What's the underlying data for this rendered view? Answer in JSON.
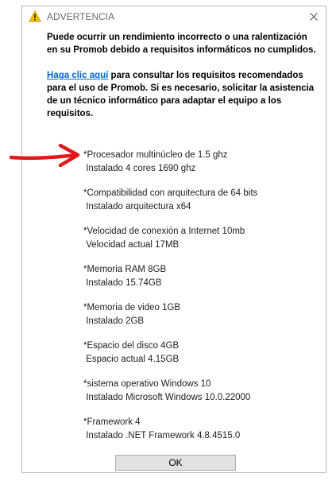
{
  "dialog": {
    "title": "ADVERTENCIA",
    "warning_message": "Puede ocurrir un rendimiento incorrecto o una ralentización en su Promob debido a requisitos informáticos no cumplidos.",
    "link_text": "Haga clic aquí",
    "info_message": " para consultar los requisitos recomendados para el uso de Promob. Si es necesario, solicitar la asistencia de un técnico informático para adaptar el equipo a los requisitos.",
    "ok_label": "OK"
  },
  "requirements": [
    {
      "required": "*Procesador multinúcleo de 1.5 ghz",
      "actual": " Instalado 4 cores 1690 ghz"
    },
    {
      "required": "*Compatibilidad con arquitectura de 64 bits",
      "actual": " Instalado arquitectura x64"
    },
    {
      "required": "*Velocidad de conexión a Internet 10mb",
      "actual": " Velocidad actual 17MB"
    },
    {
      "required": "*Memoria RAM 8GB",
      "actual": " Instalado 15.74GB"
    },
    {
      "required": "*Memoria de video 1GB",
      "actual": " Instalado 2GB"
    },
    {
      "required": "*Espacio del disco 4GB",
      "actual": " Espacio actual 4.15GB"
    },
    {
      "required": "*sistema operativo Windows 10",
      "actual": " Instalado Microsoft Windows 10.0.22000"
    },
    {
      "required": "*Framework 4",
      "actual": " Instalado .NET Framework 4.8.4515.0"
    }
  ],
  "colors": {
    "link": "#0066cc",
    "warning_icon": "#f2c200",
    "annotation_arrow": "#e0191b"
  },
  "icons": {
    "title": "warning-icon",
    "close": "close-icon",
    "annotation": "red-arrow-annotation"
  }
}
